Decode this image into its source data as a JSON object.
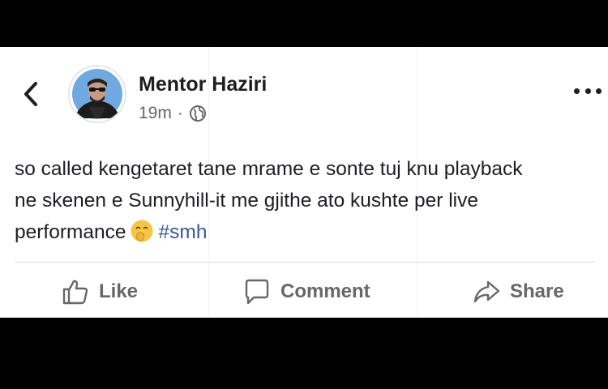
{
  "post": {
    "author_name": "Mentor Haziri",
    "timestamp": "19m",
    "separator": "·",
    "privacy_icon": "globe-icon",
    "text_lines": [
      "so called kengetaret tane mrame e sonte tuj knu playback",
      "ne skenen e Sunnyhill-it me gjithe ato kushte per live",
      "performance"
    ],
    "emoji": "shushing-face-emoji",
    "hashtag": "#smh"
  },
  "actions": {
    "like_label": "Like",
    "comment_label": "Comment",
    "share_label": "Share"
  },
  "colors": {
    "text": "#1c1e21",
    "secondary": "#65676b",
    "hashtag": "#385898"
  }
}
